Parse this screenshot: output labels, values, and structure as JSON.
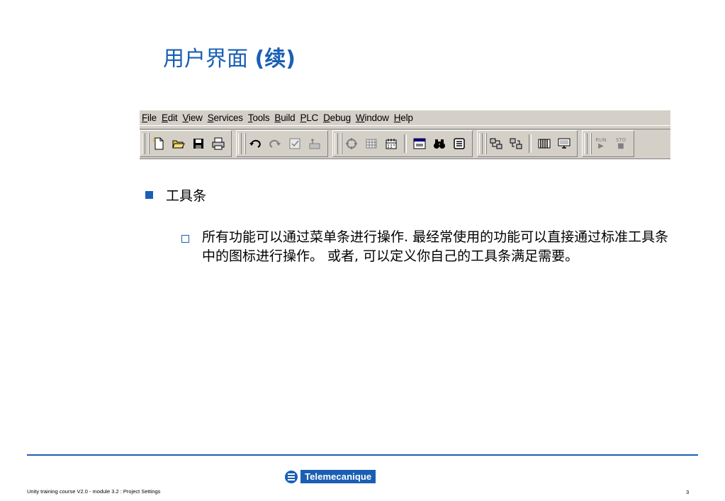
{
  "slide": {
    "title_main": "用户界面",
    "title_suffix": "(续)"
  },
  "menu": {
    "items": [
      {
        "label": "File",
        "key": "F",
        "rest": "ile"
      },
      {
        "label": "Edit",
        "key": "E",
        "rest": "dit"
      },
      {
        "label": "View",
        "key": "V",
        "rest": "iew"
      },
      {
        "label": "Services",
        "key": "S",
        "rest": "ervices"
      },
      {
        "label": "Tools",
        "key": "T",
        "rest": "ools"
      },
      {
        "label": "Build",
        "key": "B",
        "rest": "uild"
      },
      {
        "label": "PLC",
        "key": "P",
        "rest": "LC"
      },
      {
        "label": "Debug",
        "key": "D",
        "rest": "ebug"
      },
      {
        "label": "Window",
        "key": "W",
        "rest": "indow"
      },
      {
        "label": "Help",
        "key": "H",
        "rest": "elp"
      }
    ]
  },
  "toolbar": {
    "icons": [
      "new-file-icon",
      "open-folder-icon",
      "save-icon",
      "print-icon",
      "undo-icon",
      "redo-icon",
      "checkbox-icon",
      "build-icon",
      "analyze-icon",
      "grid-icon",
      "calendar-icon",
      "window-icon",
      "binoculars-icon",
      "browser-icon",
      "connect-icon",
      "disconnect-icon",
      "rack-icon",
      "monitor-icon"
    ],
    "run_label": "RUN",
    "stop_label": "STO"
  },
  "content": {
    "bullet1": "工具条",
    "bullet2": "所有功能可以通过菜单条进行操作. 最经常使用的功能可以直接通过标准工具条中的图标进行操作。 或者, 可以定义你自己的工具条满足需要。"
  },
  "footer": {
    "course": "Unity training course V2.0 - module 3.2  : Project Settings",
    "brand": "Telemecanique",
    "page": "3"
  },
  "colors": {
    "accent": "#1a5fb4",
    "toolbar_bg": "#d4d0c8"
  }
}
